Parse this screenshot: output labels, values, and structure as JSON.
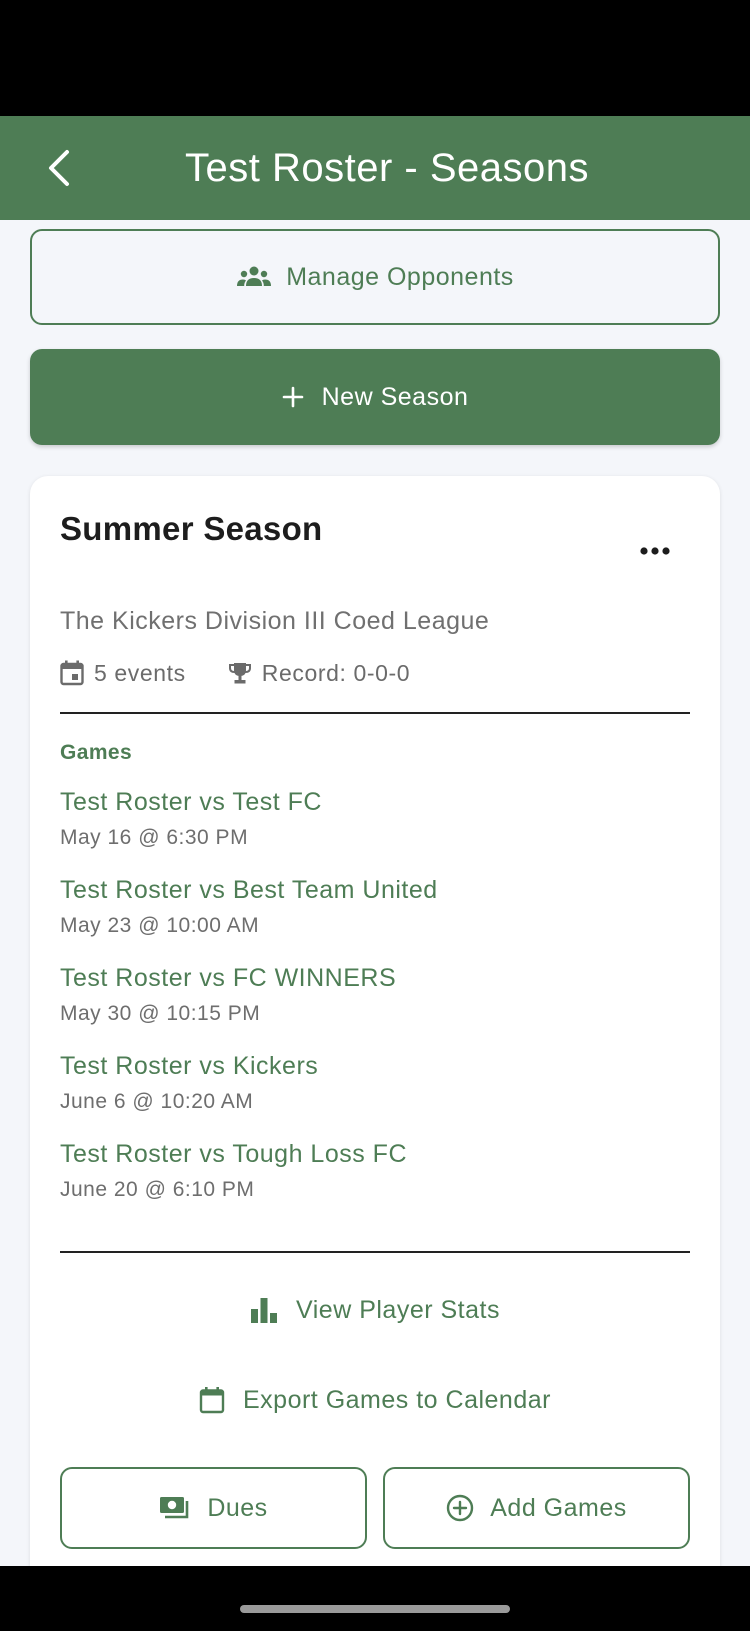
{
  "header": {
    "title": "Test Roster - Seasons",
    "back_icon": "chevron-left-icon"
  },
  "actions": {
    "manage_opponents": {
      "label": "Manage Opponents",
      "icon": "group-icon"
    },
    "new_season": {
      "label": "New Season",
      "icon": "plus-icon"
    }
  },
  "season": {
    "title": "Summer Season",
    "menu_icon": "more-horizontal-icon",
    "league": "The Kickers Division III Coed League",
    "events": "5 events",
    "record": "Record: 0-0-0",
    "games_label": "Games",
    "games": [
      {
        "title": "Test Roster vs Test FC",
        "time": "May 16 @ 6:30 PM"
      },
      {
        "title": "Test Roster vs Best Team United",
        "time": "May 23 @ 10:00 AM"
      },
      {
        "title": "Test Roster vs FC WINNERS",
        "time": "May 30 @ 10:15 PM"
      },
      {
        "title": "Test Roster vs Kickers",
        "time": "June 6 @ 10:20 AM"
      },
      {
        "title": "Test Roster vs Tough Loss FC",
        "time": "June 20 @ 6:10 PM"
      }
    ],
    "view_stats": "View Player Stats",
    "export_calendar": "Export Games to Calendar",
    "dues": "Dues",
    "add_games": "Add Games"
  },
  "colors": {
    "primary": "#4e7d55",
    "background": "#f4f6fa",
    "card": "#ffffff",
    "text_secondary": "#707070"
  }
}
